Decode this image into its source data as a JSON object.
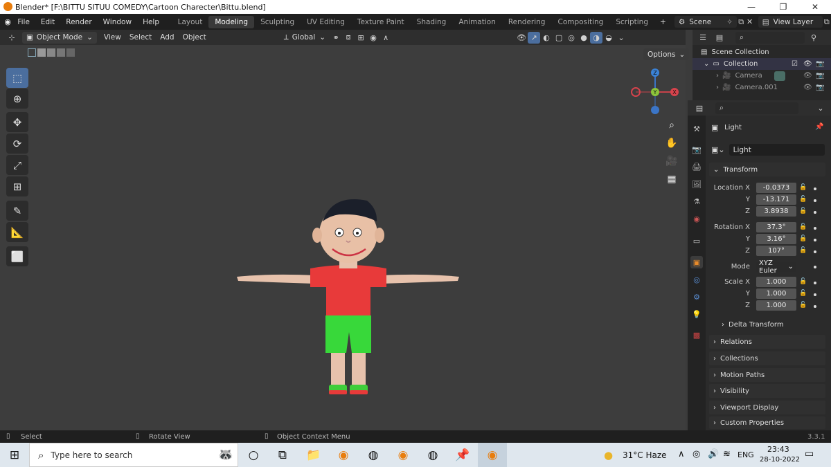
{
  "window": {
    "title": "Blender* [F:\\BITTU SITUU COMEDY\\Cartoon Charecter\\Bittu.blend]",
    "minimize": "—",
    "maximize": "❐",
    "close": "✕"
  },
  "menubar": {
    "menus": [
      "File",
      "Edit",
      "Render",
      "Window",
      "Help"
    ],
    "workspaces": [
      "Layout",
      "Modeling",
      "Sculpting",
      "UV Editing",
      "Texture Paint",
      "Shading",
      "Animation",
      "Rendering",
      "Compositing",
      "Scripting"
    ],
    "active_workspace": "Modeling",
    "add_workspace": "+",
    "scene": "Scene",
    "view_layer": "View Layer"
  },
  "viewport_header": {
    "mode": "Object Mode",
    "menus": [
      "View",
      "Select",
      "Add",
      "Object"
    ],
    "transform_orientation": "Global",
    "options": "Options"
  },
  "gizmo": {
    "z": "Z",
    "y": "Y",
    "x": "X"
  },
  "toolbar_tools": [
    {
      "name": "select-box-tool",
      "glyph": "⬚"
    },
    {
      "name": "cursor-tool",
      "glyph": "⊕"
    },
    {
      "name": "move-tool",
      "glyph": "✥"
    },
    {
      "name": "rotate-tool",
      "glyph": "⟳"
    },
    {
      "name": "scale-tool",
      "glyph": "⤢"
    },
    {
      "name": "transform-tool",
      "glyph": "⊞"
    },
    {
      "name": "annotate-tool",
      "glyph": "✎"
    },
    {
      "name": "measure-tool",
      "glyph": "📐"
    },
    {
      "name": "add-cube-tool",
      "glyph": "⬜"
    }
  ],
  "outliner": {
    "root": "Scene Collection",
    "collection": "Collection",
    "items": [
      "Camera",
      "Camera.001"
    ]
  },
  "properties": {
    "object_name": "Light",
    "data_name": "Light",
    "transform_header": "Transform",
    "location_label": "Location X",
    "rotation_label": "Rotation X",
    "scale_label": "Scale X",
    "y_label": "Y",
    "z_label": "Z",
    "location": [
      "-0.0373",
      "-13.171",
      "3.8938"
    ],
    "rotation": [
      "37.3°",
      "3.16°",
      "107°"
    ],
    "mode_label": "Mode",
    "mode_value": "XYZ Euler",
    "scale": [
      "1.000",
      "1.000",
      "1.000"
    ],
    "delta_transform": "Delta Transform",
    "panels": [
      "Relations",
      "Collections",
      "Motion Paths",
      "Visibility",
      "Viewport Display",
      "Custom Properties"
    ]
  },
  "statusbar": {
    "select": "Select",
    "rotate_view": "Rotate View",
    "context_menu": "Object Context Menu",
    "version": "3.3.1"
  },
  "taskbar": {
    "search_placeholder": "Type here to search",
    "weather": "31°C  Haze",
    "language": "ENG",
    "time": "23:43",
    "date": "28-10-2022"
  }
}
